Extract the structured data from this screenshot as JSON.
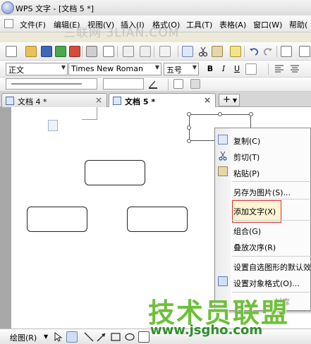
{
  "window": {
    "title": "WPS 文字 - [文档 5 *]"
  },
  "menu": [
    "文件(F)",
    "编辑(E)",
    "视图(V)",
    "插入(I)",
    "格式(O)",
    "工具(T)",
    "表格(A)",
    "窗口(W)",
    "帮助("
  ],
  "format_bar": {
    "style": "正文",
    "font": "Times New Roman",
    "size": "五号",
    "bold": "B",
    "italic": "I",
    "underline": "U"
  },
  "tabs": [
    {
      "label": "文档 4 *",
      "active": false
    },
    {
      "label": "文档 5 *",
      "active": true
    }
  ],
  "new_tab_label": "+",
  "context_menu": {
    "items": [
      "复制(C)",
      "剪切(T)",
      "粘贴(P)",
      "另存为图片(S)...",
      "添加文字(X)",
      "组合(G)",
      "叠放次序(R)",
      "设置自选图形的默认效果",
      "设置对象格式(O)...",
      "材库"
    ]
  },
  "drawbar": {
    "label": "绘图(R)"
  },
  "watermarks": {
    "top": "三联网 3LIAN.COM",
    "brand": "技术员联盟",
    "url": "www.jsgho.com"
  },
  "colors": {
    "highlight_border": "#d32f2f",
    "brand_green": "#6fbf3a"
  }
}
